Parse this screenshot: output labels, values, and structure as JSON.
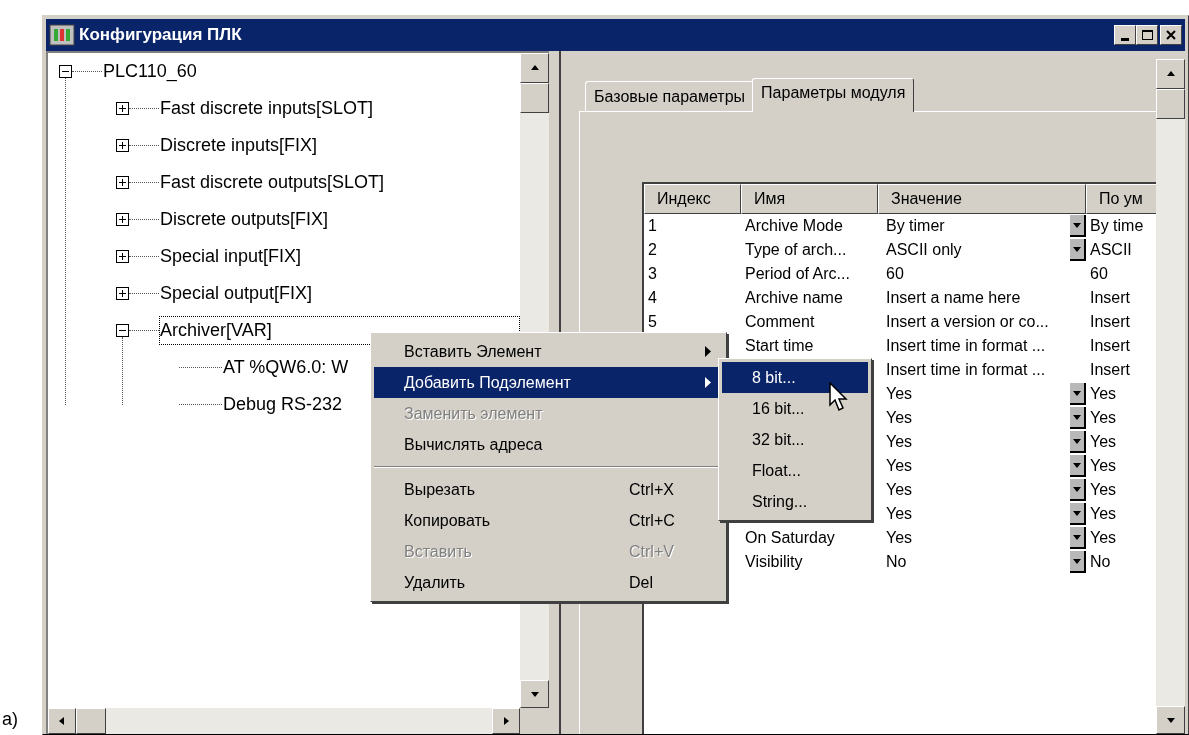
{
  "caption": "a)",
  "window": {
    "title": "Конфигурация ПЛК"
  },
  "tree": [
    {
      "label": "PLC110_60",
      "expanded": true,
      "focused": false,
      "children": [
        {
          "label": "Fast discrete inputs[SLOT]",
          "expanded": false,
          "focused": false
        },
        {
          "label": "Discrete inputs[FIX]",
          "expanded": false,
          "focused": false
        },
        {
          "label": "Fast discrete outputs[SLOT]",
          "expanded": false,
          "focused": false
        },
        {
          "label": "Discrete outputs[FIX]",
          "expanded": false,
          "focused": false
        },
        {
          "label": "Special input[FIX]",
          "expanded": false,
          "focused": false
        },
        {
          "label": "Special output[FIX]",
          "expanded": false,
          "focused": false
        },
        {
          "label": "Archiver[VAR]",
          "expanded": true,
          "focused": true,
          "children": [
            {
              "label": "AT %QW6.0: W",
              "focused": false
            },
            {
              "label": "Debug RS-232",
              "focused": false
            }
          ]
        }
      ]
    }
  ],
  "tabs": [
    {
      "label": "Базовые параметры",
      "selected": false
    },
    {
      "label": "Параметры модуля",
      "selected": true
    }
  ],
  "table": {
    "columns": [
      "Индекс",
      "Имя",
      "Значение",
      "По ум"
    ],
    "rows": [
      {
        "index": "1",
        "name": "Archive Mode",
        "value": "By timer",
        "dropdown": true,
        "default": "By time"
      },
      {
        "index": "2",
        "name": "Type of arch...",
        "value": "ASCII only",
        "dropdown": true,
        "default": "ASCII"
      },
      {
        "index": "3",
        "name": "Period of Arc...",
        "value": "60",
        "dropdown": false,
        "default": "60"
      },
      {
        "index": "4",
        "name": "Archive name",
        "value": "Insert a name here",
        "dropdown": false,
        "default": "Insert"
      },
      {
        "index": "5",
        "name": "Comment",
        "value": "Insert a version or co...",
        "dropdown": false,
        "default": "Insert"
      },
      {
        "name": "Start time",
        "value": "Insert time in format ...",
        "dropdown": false,
        "default": "Insert"
      },
      {
        "value": "Insert time in format ...",
        "dropdown": false,
        "default": "Insert"
      },
      {
        "value": "Yes",
        "dropdown": true,
        "default": "Yes"
      },
      {
        "value": "Yes",
        "dropdown": true,
        "default": "Yes"
      },
      {
        "value": "Yes",
        "dropdown": true,
        "default": "Yes"
      },
      {
        "value": "Yes",
        "dropdown": true,
        "default": "Yes"
      },
      {
        "value": "Yes",
        "dropdown": true,
        "default": "Yes"
      },
      {
        "value": "Yes",
        "dropdown": true,
        "default": "Yes"
      },
      {
        "name": "On Saturday",
        "value": "Yes",
        "dropdown": true,
        "default": "Yes"
      },
      {
        "name": "Visibility",
        "value": "No",
        "dropdown": true,
        "default": "No"
      }
    ]
  },
  "context_menu": {
    "items": [
      {
        "kind": "item",
        "label": "Вставить Элемент",
        "submenu": true,
        "disabled": false,
        "selected": false
      },
      {
        "kind": "item",
        "label": "Добавить Подэлемент",
        "submenu": true,
        "disabled": false,
        "selected": true
      },
      {
        "kind": "item",
        "label": "Заменить элемент",
        "submenu": false,
        "disabled": true,
        "selected": false
      },
      {
        "kind": "item",
        "label": "Вычислять адреса",
        "submenu": false,
        "disabled": false,
        "selected": false
      },
      {
        "kind": "separator"
      },
      {
        "kind": "item",
        "label": "Вырезать",
        "shortcut": "Ctrl+X",
        "submenu": false,
        "disabled": false,
        "selected": false
      },
      {
        "kind": "item",
        "label": "Копировать",
        "shortcut": "Ctrl+C",
        "submenu": false,
        "disabled": false,
        "selected": false
      },
      {
        "kind": "item",
        "label": "Вставить",
        "shortcut": "Ctrl+V",
        "submenu": false,
        "disabled": true,
        "selected": false
      },
      {
        "kind": "item",
        "label": "Удалить",
        "shortcut": "Del",
        "submenu": false,
        "disabled": false,
        "selected": false
      }
    ]
  },
  "submenu": {
    "items": [
      {
        "label": "8 bit...",
        "selected": true
      },
      {
        "label": "16 bit...",
        "selected": false
      },
      {
        "label": "32 bit...",
        "selected": false
      },
      {
        "label": "Float...",
        "selected": false
      },
      {
        "label": "String...",
        "selected": false
      }
    ]
  }
}
